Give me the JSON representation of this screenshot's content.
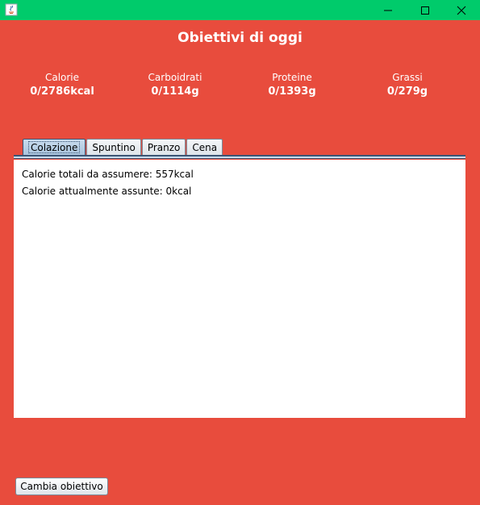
{
  "window": {
    "title": "",
    "colors": {
      "titlebar": "#00cb6b",
      "background": "#e84c3d",
      "panel": "#ffffff",
      "tab_active": "#b8d0e6"
    }
  },
  "header": {
    "title": "Obiettivi di oggi"
  },
  "stats": [
    {
      "label": "Calorie",
      "value": "0/2786kcal"
    },
    {
      "label": "Carboidrati",
      "value": "0/1114g"
    },
    {
      "label": "Proteine",
      "value": "0/1393g"
    },
    {
      "label": "Grassi",
      "value": "0/279g"
    }
  ],
  "tabs": [
    {
      "label": "Colazione",
      "active": true
    },
    {
      "label": "Spuntino",
      "active": false
    },
    {
      "label": "Pranzo",
      "active": false
    },
    {
      "label": "Cena",
      "active": false
    }
  ],
  "panel": {
    "lines": [
      "Calorie totali da assumere: 557kcal",
      "Calorie attualmente assunte: 0kcal"
    ]
  },
  "footer": {
    "change_goal_label": "Cambia obiettivo"
  },
  "icons": [
    "java-app-icon",
    "minimize-icon",
    "maximize-icon",
    "close-icon"
  ]
}
